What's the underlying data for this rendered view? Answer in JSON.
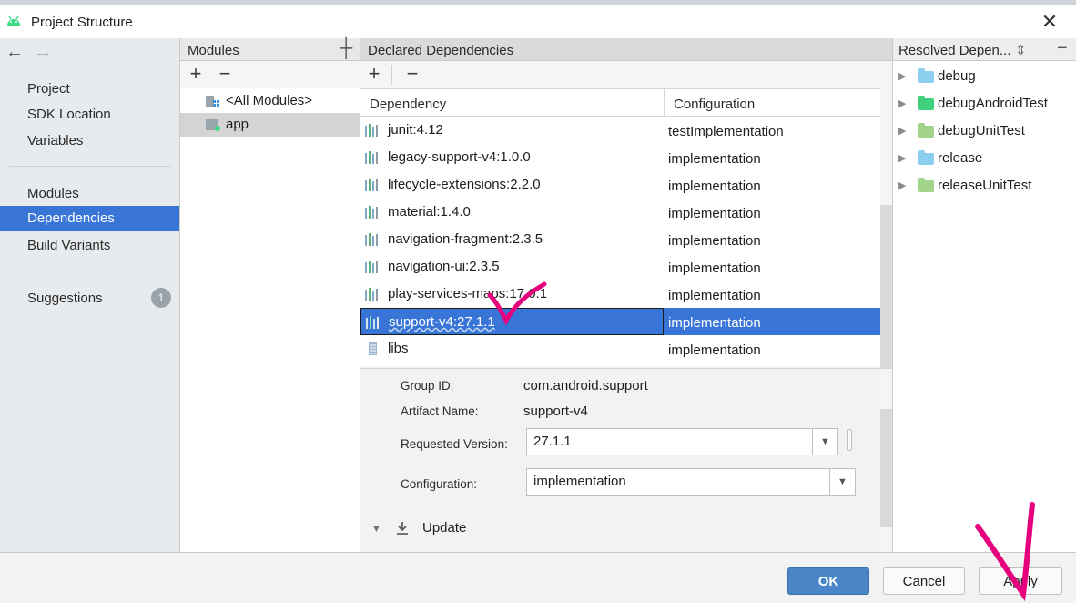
{
  "window": {
    "title": "Project Structure",
    "close_glyph": "✕"
  },
  "nav": {
    "back": "←",
    "forward": "→",
    "items": [
      {
        "label": "Project"
      },
      {
        "label": "SDK Location"
      },
      {
        "label": "Variables"
      },
      {
        "label": "Modules"
      },
      {
        "label": "Dependencies",
        "selected": true
      },
      {
        "label": "Build Variants"
      },
      {
        "label": "Suggestions",
        "badge": "1"
      }
    ]
  },
  "modules": {
    "header": "Modules",
    "add": "+",
    "remove": "−",
    "items": [
      {
        "label": "<All Modules>"
      },
      {
        "label": "app",
        "selected": true
      }
    ]
  },
  "declared": {
    "header": "Declared Dependencies",
    "add": "+",
    "remove": "−",
    "columns": {
      "dependency": "Dependency",
      "configuration": "Configuration"
    },
    "rows": [
      {
        "dependency": "junit:4.12",
        "configuration": "testImplementation"
      },
      {
        "dependency": "legacy-support-v4:1.0.0",
        "configuration": "implementation"
      },
      {
        "dependency": "lifecycle-extensions:2.2.0",
        "configuration": "implementation"
      },
      {
        "dependency": "material:1.4.0",
        "configuration": "implementation"
      },
      {
        "dependency": "navigation-fragment:2.3.5",
        "configuration": "implementation"
      },
      {
        "dependency": "navigation-ui:2.3.5",
        "configuration": "implementation"
      },
      {
        "dependency": "play-services-maps:17.0.1",
        "configuration": "implementation"
      },
      {
        "dependency": "support-v4:27.1.1",
        "configuration": "implementation",
        "selected": true
      },
      {
        "dependency": "libs",
        "configuration": "implementation"
      }
    ],
    "details": {
      "group_label": "Group ID:",
      "group_value": "com.android.support",
      "artifact_label": "Artifact Name:",
      "artifact_value": "support-v4",
      "version_label": "Requested Version:",
      "version_value": "27.1.1",
      "config_label": "Configuration:",
      "config_value": "implementation",
      "update_label": "Update"
    }
  },
  "resolved": {
    "header": "Resolved Depen...",
    "items": [
      {
        "label": "debug",
        "color": "#8ccfee"
      },
      {
        "label": "debugAndroidTest",
        "color": "#3fcf7c"
      },
      {
        "label": "debugUnitTest",
        "color": "#a3d48c"
      },
      {
        "label": "release",
        "color": "#8ccfee"
      },
      {
        "label": "releaseUnitTest",
        "color": "#a3d48c"
      }
    ]
  },
  "buttons": {
    "ok": "OK",
    "cancel": "Cancel",
    "apply": "Apply"
  },
  "colors": {
    "selection": "#3875d7",
    "annotation": "#e6007e"
  }
}
